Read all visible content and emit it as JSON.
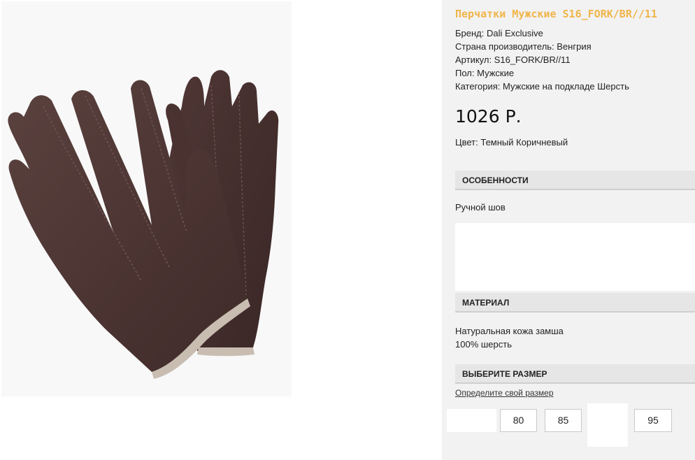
{
  "product": {
    "title": "Перчатки Мужские S16_FORK/BR//11",
    "specs": [
      "Бренд: Dali Exclusive",
      "Страна производитель: Венгрия",
      "Артикул: S16_FORK/BR//11",
      "Пол: Мужские",
      "Категория: Мужские на подкладе Шерсть"
    ],
    "price": "1026 Р.",
    "color": "Цвет: Темный Коричневый"
  },
  "features": {
    "header": "ОСОБЕННОСТИ",
    "text": "Ручной шов"
  },
  "material": {
    "header": "МАТЕРИАЛ",
    "lines": [
      "Натуральная кожа замша",
      "100% шерсть"
    ]
  },
  "sizes": {
    "header": "ВЫБЕРИТЕ РАЗМЕР",
    "guide_link": "Определите свой размер",
    "options": [
      "",
      "80",
      "85",
      "",
      "95"
    ]
  },
  "colors": {
    "title_accent": "#f0b54a",
    "panel_bg": "#f2f2f2",
    "glove_suede": "#4e3633",
    "glove_cuff": "#c9bdb2"
  }
}
